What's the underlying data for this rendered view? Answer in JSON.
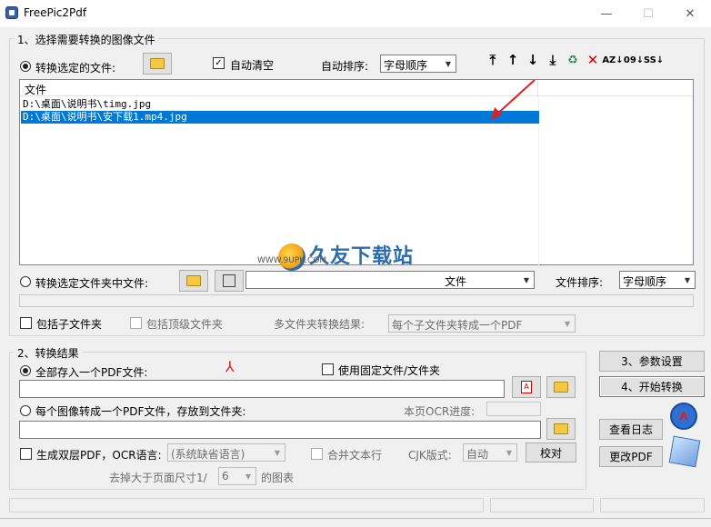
{
  "window": {
    "title": "FreePic2Pdf",
    "minimize": "—",
    "maximize": "☐",
    "close": "✕"
  },
  "group1": {
    "legend": "1、选择需要转换的图像文件",
    "radio_files_label": "转换选定的文件:",
    "auto_clear_label": "自动清空",
    "auto_sort_label": "自动排序:",
    "auto_sort_value": "字母顺序",
    "list_header": "文件",
    "files": [
      "D:\\桌面\\说明书\\timg.jpg",
      "D:\\桌面\\说明书\\安下载1.mp4.jpg"
    ],
    "radio_folder_label": "转换选定文件夹中文件:",
    "folder_select_value": "文件",
    "file_sort_label": "文件排序:",
    "file_sort_value": "字母顺序",
    "include_sub_label": "包括子文件夹",
    "include_top_label": "包括顶级文件夹",
    "multi_result_label": "多文件夹转换结果:",
    "multi_result_value": "每个子文件夹转成一个PDF"
  },
  "toolbar_icons": [
    "move-top-icon",
    "move-up-icon",
    "move-down-icon",
    "move-bottom-icon",
    "recycle-icon",
    "delete-icon",
    "sort-az-icon",
    "sort-09-icon",
    "sort-ss-icon"
  ],
  "watermark": {
    "brand": "久友下载站",
    "url": "Www.9UPK.Com",
    "small": "WWW.9UPK.COM"
  },
  "group2": {
    "legend": "2、转换结果",
    "all_in_one_label": "全部存入一个PDF文件:",
    "fixed_folder_label": "使用固定文件/文件夹",
    "each_image_label": "每个图像转成一个PDF文件，存放到文件夹:",
    "ocr_progress_label": "本页OCR进度:",
    "double_layer_label": "生成双层PDF，OCR语言:",
    "ocr_lang_value": "(系统缺省语言)",
    "merge_lines_label": "合并文本行",
    "cjk_label": "CJK版式:",
    "cjk_value": "自动",
    "proofread_label": "校对",
    "remove_prefix": "去掉大于页面尺寸1/",
    "remove_value": "6",
    "remove_suffix": "的图表"
  },
  "side": {
    "settings_label": "3、参数设置",
    "start_label": "4、开始转换",
    "log_label": "查看日志",
    "edit_pdf_label": "更改PDF"
  }
}
